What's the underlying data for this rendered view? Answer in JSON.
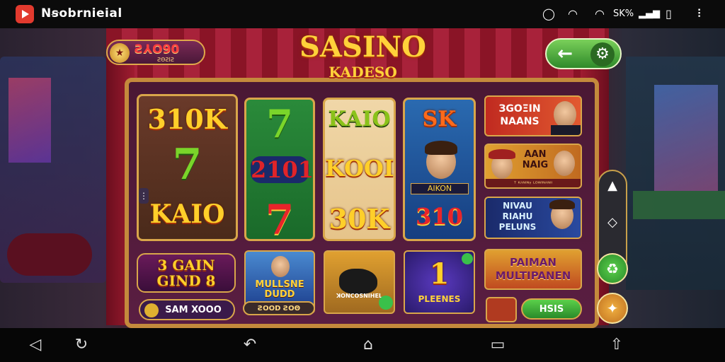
{
  "status_bar": {
    "app_name": "Nꞩobrnieial",
    "signal_text": "SK%"
  },
  "header": {
    "coin_value": "Ƨ⅄O90",
    "coin_sub": "ƧΘƧΙƧ",
    "logo_line1": "SASINO",
    "logo_line2": "KADESO"
  },
  "reels": [
    {
      "symbols": [
        "310K",
        "7",
        "KAIO"
      ]
    },
    {
      "symbols": [
        "7",
        "2101",
        "7"
      ]
    },
    {
      "symbols": [
        "KAIO",
        "KOOI",
        "30K"
      ]
    },
    {
      "symbols": [
        "SK",
        "AIKON",
        "310"
      ]
    }
  ],
  "promo_cards": [
    {
      "title": "ЗGOΞIN\nNAANS"
    },
    {
      "title": "AAN\nNAIG",
      "footer": "ᵀ ᴷᴬᴺᴵᴺᵞ   ᴸᴼᵂᴵᴺᴬᴺᴵᴵ"
    },
    {
      "title": "NIVAU\nRIAHU\nPELUNS"
    }
  ],
  "bottom_row": {
    "jackpot": "3 GAIN\nGIND 8",
    "jackpot_sub": "SAM XOOO",
    "hero_card": "MULLSNE\nDUDD",
    "hero_sub": "ƧOOD ƧOΘ",
    "pig_card": "ꓘONCOSNIHEL",
    "one_card_num": "1",
    "one_card_label": "PLEENES",
    "multiplier": "PAIMAN\nMULTIPANEN",
    "multi_btn": "HSIS"
  },
  "navigation": [
    "back",
    "assist",
    "undo",
    "home",
    "recents",
    "share"
  ]
}
